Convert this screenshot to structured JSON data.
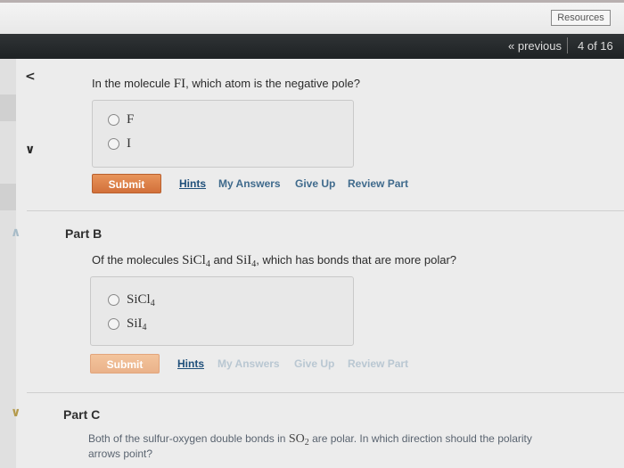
{
  "header": {
    "resources_label": "Resources",
    "previous_label": "« previous",
    "page_counter": "4 of 16"
  },
  "partA": {
    "question_prefix": "In the molecule ",
    "molecule": "FI",
    "question_suffix": ", which atom is the negative pole?",
    "options": [
      "F",
      "I"
    ],
    "submit_label": "Submit",
    "links": {
      "hints": "Hints",
      "my_answers": "My Answers",
      "give_up": "Give Up",
      "review_part": "Review Part"
    }
  },
  "partB": {
    "title": "Part B",
    "question_prefix": "Of the molecules ",
    "mol1": "SiCl",
    "mol1_sub": "4",
    "and": " and ",
    "mol2": "SiI",
    "mol2_sub": "4",
    "question_suffix": ", which has bonds that are more polar?",
    "options": [
      {
        "base": "SiCl",
        "sub": "4"
      },
      {
        "base": "SiI",
        "sub": "4"
      }
    ],
    "submit_label": "Submit",
    "links": {
      "hints": "Hints",
      "my_answers": "My Answers",
      "give_up": "Give Up",
      "review_part": "Review Part"
    }
  },
  "partC": {
    "title": "Part C",
    "text_prefix": "Both of the sulfur-oxygen double bonds in ",
    "molecule": "SO",
    "molecule_sub": "2",
    "text_suffix": " are polar. In which direction should the polarity",
    "text_line2": "arrows point?"
  },
  "colors": {
    "submit_active": "#d2703a",
    "submit_disabled": "#eab28a",
    "navbar": "#1e2224",
    "hints_link": "#1f4f7a"
  }
}
